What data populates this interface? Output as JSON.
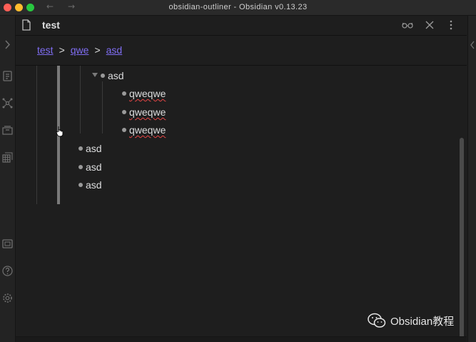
{
  "window": {
    "title": "obsidian-outliner - Obsidian v0.13.23",
    "nav_back_glyph": "←",
    "nav_forward_glyph": "→"
  },
  "left_ribbon": {
    "icons": [
      "collapse-arrow-icon",
      "open-quick-switcher-icon",
      "graph-view-icon",
      "archive-icon",
      "grid-icon",
      "vault-icon",
      "help-icon",
      "settings-icon"
    ]
  },
  "view_header": {
    "title": "test",
    "actions": [
      "reading-view-icon",
      "close-icon",
      "more-options-icon"
    ]
  },
  "breadcrumb": {
    "items": [
      "test",
      "qwe",
      "asd"
    ],
    "separator": ">"
  },
  "outline": {
    "parent": "asd",
    "children": [
      "qweqwe",
      "qweqwe",
      "qweqwe"
    ],
    "siblings": [
      "asd",
      "asd",
      "asd"
    ]
  },
  "watermark": {
    "text": "Obsidian教程"
  },
  "colors": {
    "accent": "#7f6df2",
    "background": "#1e1e1e",
    "text": "#dcddde",
    "spellcheck": "#e84545"
  }
}
